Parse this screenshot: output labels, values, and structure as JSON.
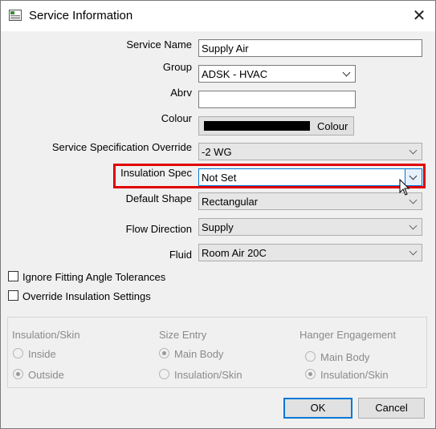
{
  "window": {
    "title": "Service Information",
    "close_glyph": "✕"
  },
  "form": {
    "service_name": {
      "label": "Service Name",
      "value": "Supply Air"
    },
    "group": {
      "label": "Group",
      "value": "ADSK - HVAC"
    },
    "abrv": {
      "label": "Abrv",
      "value": ""
    },
    "colour": {
      "label": "Colour",
      "button_label": "Colour",
      "swatch_color": "#000000"
    },
    "spec_override": {
      "label": "Service Specification Override",
      "value": "-2 WG"
    },
    "insulation_spec": {
      "label": "Insulation Spec",
      "value": "Not Set"
    },
    "default_shape": {
      "label": "Default Shape",
      "value": "Rectangular"
    },
    "flow_direction": {
      "label": "Flow Direction",
      "value": "Supply"
    },
    "fluid": {
      "label": "Fluid",
      "value": "Room Air 20C"
    }
  },
  "checkboxes": {
    "ignore_tolerances": {
      "label": "Ignore Fitting Angle Tolerances",
      "checked": false
    },
    "override_insulation": {
      "label": "Override Insulation Settings",
      "checked": false
    }
  },
  "insulation_group": {
    "insulation_skin": {
      "heading": "Insulation/Skin",
      "inside": "Inside",
      "outside": "Outside",
      "selected": "Outside"
    },
    "size_entry": {
      "heading": "Size Entry",
      "main_body": "Main Body",
      "insulation_skin": "Insulation/Skin",
      "selected": "Main Body"
    },
    "hanger_engagement": {
      "heading": "Hanger Engagement",
      "main_body": "Main Body",
      "insulation_skin": "Insulation/Skin",
      "selected": "Insulation/Skin"
    }
  },
  "buttons": {
    "ok": "OK",
    "cancel": "Cancel"
  },
  "colors": {
    "highlight": "#e00000",
    "focus": "#0078d7"
  }
}
